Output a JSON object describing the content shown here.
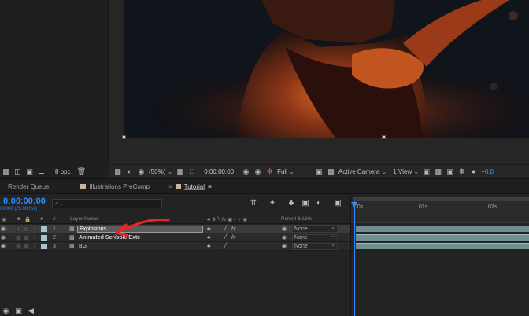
{
  "viewer": {
    "zoom": "(50%)",
    "timecode": "0:00:00:00",
    "resolution": "Full",
    "camera": "Active Camera",
    "views": "1 View",
    "exposure": "+0.0",
    "bpc": "8 bpc"
  },
  "tabs": [
    {
      "label": "Render Queue"
    },
    {
      "label": "Illustrations PreComp"
    },
    {
      "label": "Tutorial"
    }
  ],
  "timeline": {
    "timecode": "0:00:00:00",
    "fps": "00000 (25.00 fps)",
    "search_placeholder": "⌕⌄",
    "columns": {
      "num": "#",
      "layer_name": "Layer Name",
      "parent": "Parent & Link"
    },
    "ruler": [
      "00s",
      "01s",
      "02s"
    ],
    "layers": [
      {
        "num": "1",
        "name": "Explosions",
        "parent": "None",
        "selected": true
      },
      {
        "num": "2",
        "name": "Animated Scribble Exte",
        "parent": "None",
        "selected": false
      },
      {
        "num": "3",
        "name": "BG",
        "parent": "None",
        "selected": false
      }
    ]
  },
  "annotation": {
    "color": "#e8262a",
    "icon": "red-arrow"
  },
  "colors": {
    "accent": "#2e8cff",
    "layer_label": "#a7c5c6"
  }
}
